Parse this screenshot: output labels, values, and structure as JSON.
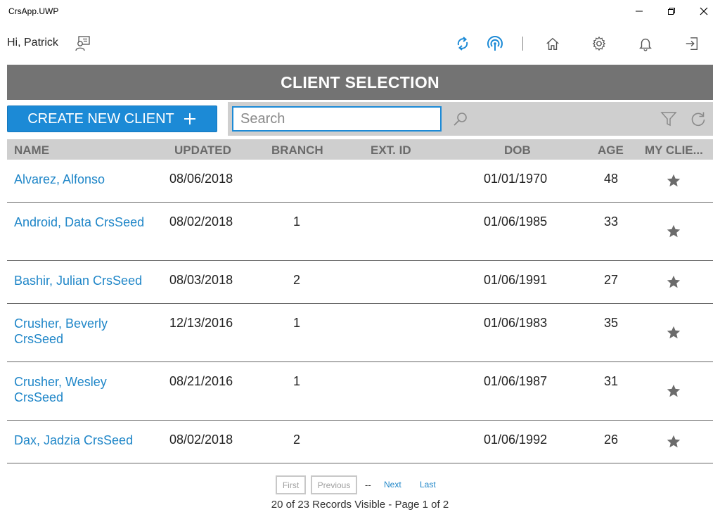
{
  "window": {
    "title": "CrsApp.UWP"
  },
  "toolbar": {
    "greeting": "Hi, Patrick"
  },
  "page": {
    "title": "CLIENT SELECTION"
  },
  "actions": {
    "create_label": "CREATE NEW CLIENT",
    "search_placeholder": "Search",
    "search_value": ""
  },
  "table": {
    "columns": [
      "NAME",
      "UPDATED",
      "BRANCH",
      "EXT. ID",
      "DOB",
      "AGE",
      "MY CLIE..."
    ],
    "rows": [
      {
        "name": "Alvarez, Alfonso",
        "updated": "08/06/2018",
        "branch": "",
        "ext_id": "",
        "dob": "01/01/1970",
        "age": "48",
        "my_client": true
      },
      {
        "name": "Android, Data CrsSeed",
        "updated": "08/02/2018",
        "branch": "1",
        "ext_id": "",
        "dob": "01/06/1985",
        "age": "33",
        "my_client": true
      },
      {
        "name": "Bashir, Julian CrsSeed",
        "updated": "08/03/2018",
        "branch": "2",
        "ext_id": "",
        "dob": "01/06/1991",
        "age": "27",
        "my_client": true
      },
      {
        "name": "Crusher, Beverly CrsSeed",
        "updated": "12/13/2016",
        "branch": "1",
        "ext_id": "",
        "dob": "01/06/1983",
        "age": "35",
        "my_client": true
      },
      {
        "name": "Crusher, Wesley CrsSeed",
        "updated": "08/21/2016",
        "branch": "1",
        "ext_id": "",
        "dob": "01/06/1987",
        "age": "31",
        "my_client": true
      },
      {
        "name": "Dax, Jadzia CrsSeed",
        "updated": "08/02/2018",
        "branch": "2",
        "ext_id": "",
        "dob": "01/06/1992",
        "age": "26",
        "my_client": true
      }
    ]
  },
  "pager": {
    "first": "First",
    "previous": "Previous",
    "separator": "--",
    "next": "Next",
    "last": "Last",
    "status": "20 of  23 Records Visible -  Page 1 of  2"
  },
  "colors": {
    "accent": "#1c8ad6",
    "link": "#1f86c8",
    "header_band": "#737373",
    "panel_gray": "#cfcfcf",
    "star": "#6b6b6b"
  },
  "icons": {
    "minimize": "minimize-icon",
    "maximize": "restore-icon",
    "close": "close-icon",
    "profile": "user-chat-icon",
    "sync": "sync-icon",
    "signal": "broadcast-icon",
    "home": "home-icon",
    "settings": "gear-icon",
    "notifications": "bell-icon",
    "logout": "logout-icon",
    "add": "plus-icon",
    "search": "search-icon",
    "filter": "filter-icon",
    "refresh": "refresh-icon",
    "favorite": "star-icon"
  }
}
